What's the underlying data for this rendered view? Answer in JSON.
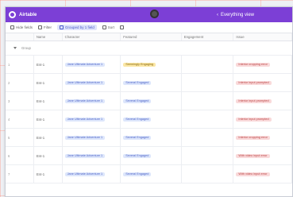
{
  "topbar": {
    "app_name": "Airtable",
    "view_name": "Everything view"
  },
  "toolbar": {
    "items": [
      "Hide fields",
      "Filter",
      "Grouped by 1 field",
      "Sort"
    ]
  },
  "columns": [
    "",
    "Name",
    "Character",
    "Featured",
    "Engagement",
    "Issue"
  ],
  "group_label": "Group",
  "rows": [
    {
      "num": "1",
      "id": "Ent-1",
      "character": "Jane Ultimate Adventure 1",
      "featured": "Seemingly Engaging",
      "engagement": "",
      "issue": "Interior cropping error"
    },
    {
      "num": "2",
      "id": "Ent-1",
      "character": "Jane Ultimate Adventure 1",
      "featured": "Several Engaged",
      "engagement": "",
      "issue": "Interior input prompted"
    },
    {
      "num": "3",
      "id": "Ent-1",
      "character": "Jane Ultimate Adventure 1",
      "featured": "Several Engaged",
      "engagement": "",
      "issue": "Interior input prompted"
    },
    {
      "num": "4",
      "id": "Ent-1",
      "character": "Jane Ultimate Adventure 1",
      "featured": "Several Engaged",
      "engagement": "",
      "issue": "Interior input prompted"
    },
    {
      "num": "5",
      "id": "Ent-1",
      "character": "Jane Ultimate Adventure 1",
      "featured": "Several Engaged",
      "engagement": "",
      "issue": "Interior cropping error"
    },
    {
      "num": "6",
      "id": "Ent-1",
      "character": "Jane Ultimate Adventure 1",
      "featured": "Several Engaged",
      "engagement": "",
      "issue": "With video input error"
    },
    {
      "num": "7",
      "id": "Ent-1",
      "character": "Jane Ultimate Adventure 1",
      "featured": "Several Engaged",
      "engagement": "",
      "issue": "With video input error"
    }
  ]
}
